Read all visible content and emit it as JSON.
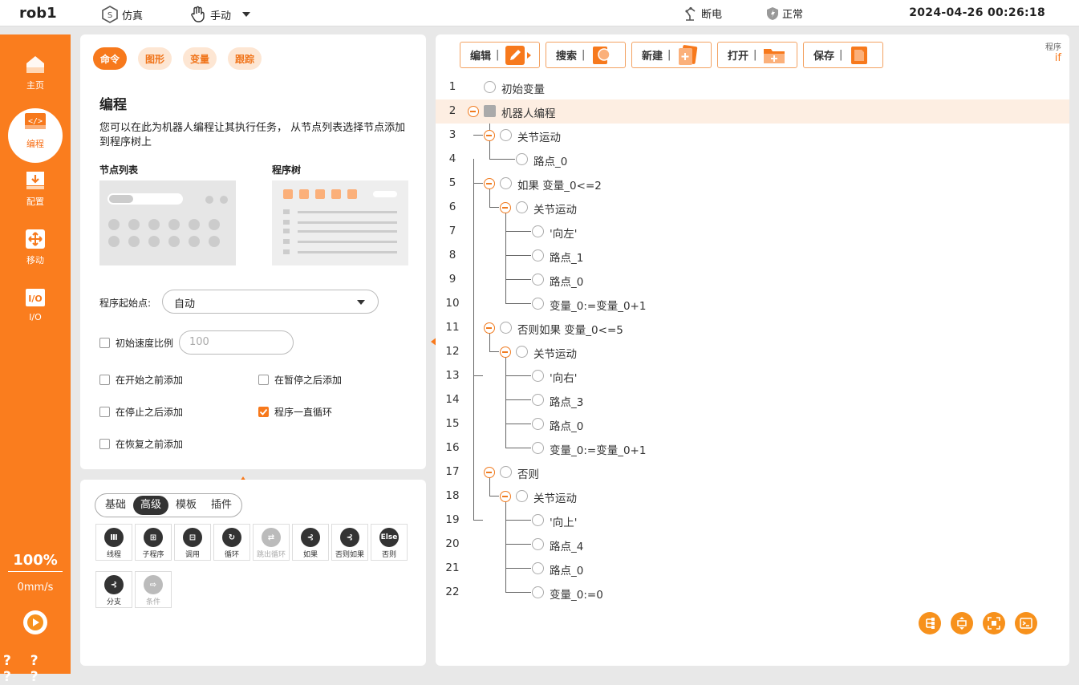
{
  "topbar": {
    "robot": "rob1",
    "sim_label": "仿真",
    "mode_label": "手动",
    "power_label": "断电",
    "status_label": "正常",
    "datetime": "2024-04-26 00:26:18"
  },
  "sidebar": {
    "items": [
      {
        "label": "主页",
        "icon": "home-icon"
      },
      {
        "label": "编程",
        "icon": "code-icon"
      },
      {
        "label": "配置",
        "icon": "config-icon"
      },
      {
        "label": "移动",
        "icon": "move-icon"
      },
      {
        "label": "I/O",
        "icon": "io-icon"
      }
    ],
    "speed_percent": "100%",
    "speed_mm": "0mm/s",
    "help": "? ? ? ?"
  },
  "left_panel": {
    "tabs": [
      "命令",
      "图形",
      "变量",
      "跟踪"
    ],
    "title": "编程",
    "description": "您可以在此为机器人编程让其执行任务， 从节点列表选择节点添加到程序树上",
    "node_list_label": "节点列表",
    "program_tree_label": "程序树",
    "start_point_label": "程序起始点:",
    "start_point_value": "自动",
    "init_speed_label": "初始速度比例",
    "init_speed_placeholder": "100",
    "checks": {
      "before_start": "在开始之前添加",
      "after_pause": "在暂停之后添加",
      "after_stop": "在停止之后添加",
      "loop": "程序一直循环",
      "before_resume": "在恢复之前添加"
    }
  },
  "nodes_panel": {
    "categories": [
      "基础",
      "高级",
      "模板",
      "插件"
    ],
    "nodes": [
      {
        "label": "线程",
        "glyph": "Ⅲ"
      },
      {
        "label": "子程序",
        "glyph": "⊞"
      },
      {
        "label": "调用",
        "glyph": "⊟"
      },
      {
        "label": "循环",
        "glyph": "↻"
      },
      {
        "label": "跳出循环",
        "glyph": "⇄"
      },
      {
        "label": "如果",
        "glyph": "⊰"
      },
      {
        "label": "否则如果",
        "glyph": "⊰"
      },
      {
        "label": "否则",
        "glyph": "Else"
      },
      {
        "label": "分支",
        "glyph": "⊰"
      },
      {
        "label": "条件",
        "glyph": "⇨"
      }
    ]
  },
  "toolbar": {
    "edit": "编辑",
    "search": "搜索",
    "new": "新建",
    "open": "打开",
    "save": "保存",
    "program_label": "程序",
    "program_value": "if"
  },
  "tree": [
    {
      "n": "1",
      "text": "初始变量"
    },
    {
      "n": "2",
      "text": "机器人编程"
    },
    {
      "n": "3",
      "text": "关节运动"
    },
    {
      "n": "4",
      "text": "路点_0"
    },
    {
      "n": "5",
      "text": "如果 变量_0<=2"
    },
    {
      "n": "6",
      "text": "关节运动"
    },
    {
      "n": "7",
      "text": "'向左'"
    },
    {
      "n": "8",
      "text": "路点_1"
    },
    {
      "n": "9",
      "text": "路点_0"
    },
    {
      "n": "10",
      "text": "变量_0:=变量_0+1"
    },
    {
      "n": "11",
      "text": "否则如果 变量_0<=5"
    },
    {
      "n": "12",
      "text": "关节运动"
    },
    {
      "n": "13",
      "text": "'向右'"
    },
    {
      "n": "14",
      "text": "路点_3"
    },
    {
      "n": "15",
      "text": "路点_0"
    },
    {
      "n": "16",
      "text": "变量_0:=变量_0+1"
    },
    {
      "n": "17",
      "text": "否则"
    },
    {
      "n": "18",
      "text": "关节运动"
    },
    {
      "n": "19",
      "text": "'向上'"
    },
    {
      "n": "20",
      "text": "路点_4"
    },
    {
      "n": "21",
      "text": "路点_0"
    },
    {
      "n": "22",
      "text": "变量_0:=0"
    }
  ]
}
